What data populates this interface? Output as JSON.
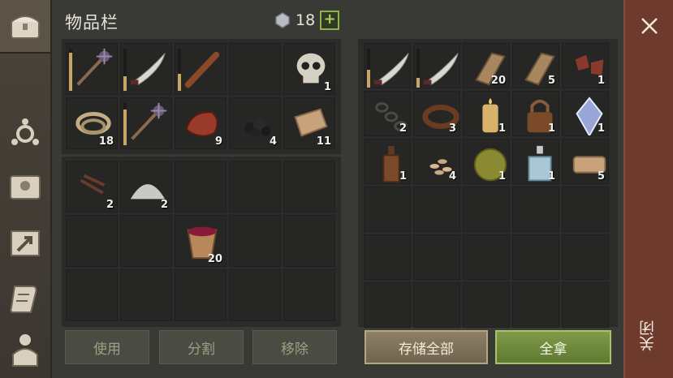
{
  "inventory": {
    "title": "物品栏",
    "currency_value": "18",
    "add_label": "+",
    "slots_top": [
      {
        "icon": "mace-icon",
        "count": "",
        "durability": 0.9
      },
      {
        "icon": "machete-icon",
        "count": "",
        "durability": 0.35
      },
      {
        "icon": "wooden-club-icon",
        "count": "",
        "durability": 0.4
      },
      {
        "icon": "",
        "count": ""
      },
      {
        "icon": "skull-icon",
        "count": "1"
      },
      {
        "icon": "rope-icon",
        "count": "18"
      },
      {
        "icon": "mace-icon",
        "count": "",
        "durability": 0.85
      },
      {
        "icon": "raw-meat-icon",
        "count": "9"
      },
      {
        "icon": "coal-icon",
        "count": "4"
      },
      {
        "icon": "cloth-icon",
        "count": "11"
      }
    ],
    "slots_bottom": [
      {
        "icon": "nails-icon",
        "count": "2"
      },
      {
        "icon": "powder-pile-icon",
        "count": "2"
      },
      {
        "icon": "",
        "count": ""
      },
      {
        "icon": "",
        "count": ""
      },
      {
        "icon": "",
        "count": ""
      },
      {
        "icon": "",
        "count": ""
      },
      {
        "icon": "",
        "count": ""
      },
      {
        "icon": "bucket-red-icon",
        "count": "20"
      },
      {
        "icon": "",
        "count": ""
      },
      {
        "icon": "",
        "count": ""
      },
      {
        "icon": "",
        "count": ""
      },
      {
        "icon": "",
        "count": ""
      },
      {
        "icon": "",
        "count": ""
      },
      {
        "icon": "",
        "count": ""
      },
      {
        "icon": "",
        "count": ""
      }
    ],
    "buttons": {
      "use": "使用",
      "split": "分割",
      "remove": "移除"
    }
  },
  "storage": {
    "slots": [
      {
        "icon": "machete-icon",
        "count": "",
        "durability": 0.5
      },
      {
        "icon": "machete-icon",
        "count": "",
        "durability": 0.3
      },
      {
        "icon": "wooden-plank-icon",
        "count": "20"
      },
      {
        "icon": "wooden-plank-icon",
        "count": "5"
      },
      {
        "icon": "leather-scraps-icon",
        "count": "1"
      },
      {
        "icon": "chain-icon",
        "count": "2"
      },
      {
        "icon": "leather-strap-icon",
        "count": "3"
      },
      {
        "icon": "candle-icon",
        "count": "1"
      },
      {
        "icon": "padlock-icon",
        "count": "1"
      },
      {
        "icon": "crystal-icon",
        "count": "1"
      },
      {
        "icon": "bottle-icon",
        "count": "1"
      },
      {
        "icon": "seeds-icon",
        "count": "4"
      },
      {
        "icon": "hay-ball-icon",
        "count": "1"
      },
      {
        "icon": "potion-flask-icon",
        "count": "1"
      },
      {
        "icon": "folded-cloth-icon",
        "count": "5"
      }
    ],
    "buttons": {
      "store_all": "存储全部",
      "take_all": "全拿"
    }
  },
  "close": {
    "label": "关闭"
  },
  "colors": {
    "accent_green": "#7f9a48",
    "close_panel": "#6e3a2c",
    "durability": "#c7a564"
  }
}
